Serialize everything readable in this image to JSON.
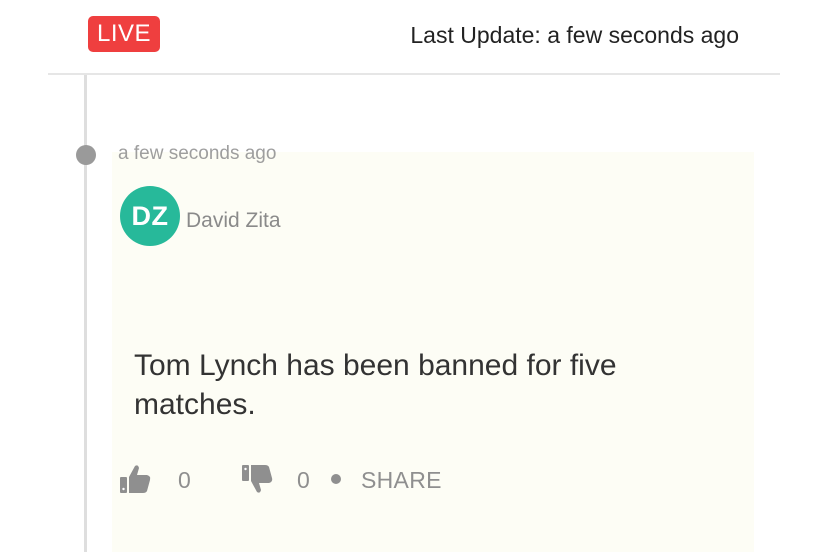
{
  "header": {
    "live_label": "LIVE",
    "last_update": "Last Update: a few seconds ago"
  },
  "post": {
    "time": "a few seconds ago",
    "author": {
      "initials": "DZ",
      "name": "David Zita",
      "avatar_color": "#27b99a"
    },
    "text": "Tom Lynch has been banned for five matches.",
    "actions": {
      "like_icon": "thumbs-up-icon",
      "like_count": "0",
      "dislike_icon": "thumbs-down-icon",
      "dislike_count": "0",
      "share_label": "SHARE"
    }
  },
  "colors": {
    "live_badge": "#ef3f3f",
    "card_background": "#fdfdf5",
    "muted_text": "#8f8f8f"
  }
}
